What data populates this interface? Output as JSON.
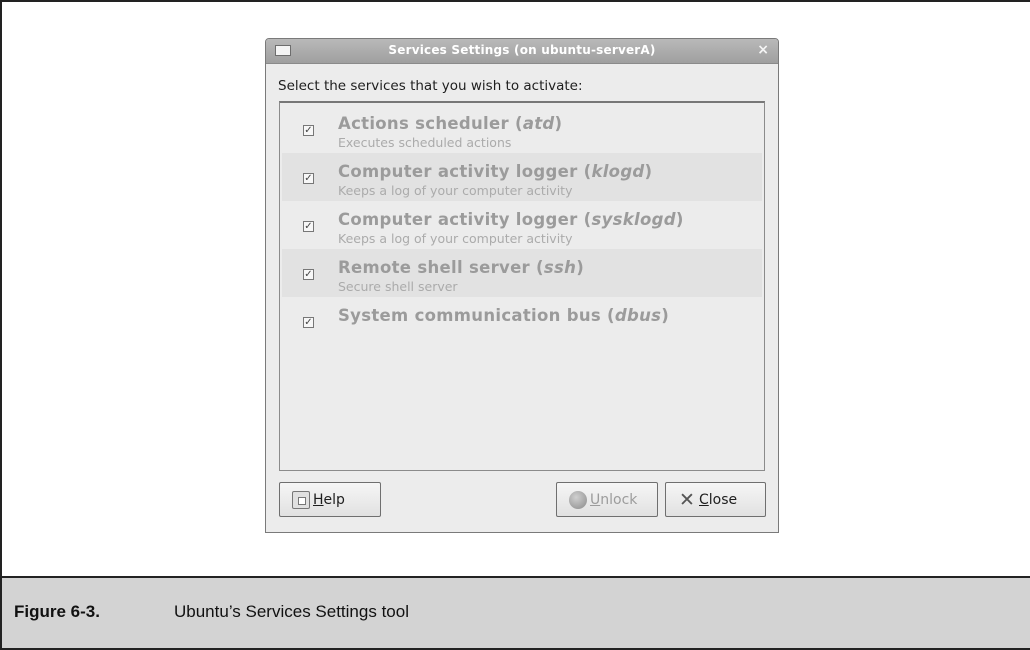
{
  "figure": {
    "number": "Figure 6-3.",
    "caption": "Ubuntu’s Services Settings tool"
  },
  "window": {
    "title": "Services Settings (on ubuntu-serverA)",
    "close_glyph": "×",
    "prompt": "Select the services that you wish to activate:"
  },
  "services": [
    {
      "name": "Actions scheduler (",
      "daemon": "atd",
      "suffix": ")",
      "description": "Executes scheduled actions",
      "checked": true,
      "check_glyph": "✓"
    },
    {
      "name": "Computer activity logger (",
      "daemon": "klogd",
      "suffix": ")",
      "description": "Keeps a log of your computer activity",
      "checked": true,
      "check_glyph": "✓"
    },
    {
      "name": "Computer activity logger (",
      "daemon": "sysklogd",
      "suffix": ")",
      "description": "Keeps a log of your computer activity",
      "checked": true,
      "check_glyph": "✓"
    },
    {
      "name": "Remote shell server (",
      "daemon": "ssh",
      "suffix": ")",
      "description": "Secure shell server",
      "checked": true,
      "check_glyph": "✓"
    },
    {
      "name": "System communication bus (",
      "daemon": "dbus",
      "suffix": ")",
      "description": "",
      "checked": true,
      "check_glyph": "✓"
    }
  ],
  "buttons": {
    "help": {
      "mnemonic": "H",
      "rest": "elp",
      "icon": "help-icon"
    },
    "unlock": {
      "mnemonic": "U",
      "rest": "nlock",
      "icon": "lock-icon",
      "enabled": false
    },
    "close": {
      "mnemonic": "C",
      "rest": "lose",
      "icon": "close-icon",
      "close_glyph": "✕"
    }
  }
}
